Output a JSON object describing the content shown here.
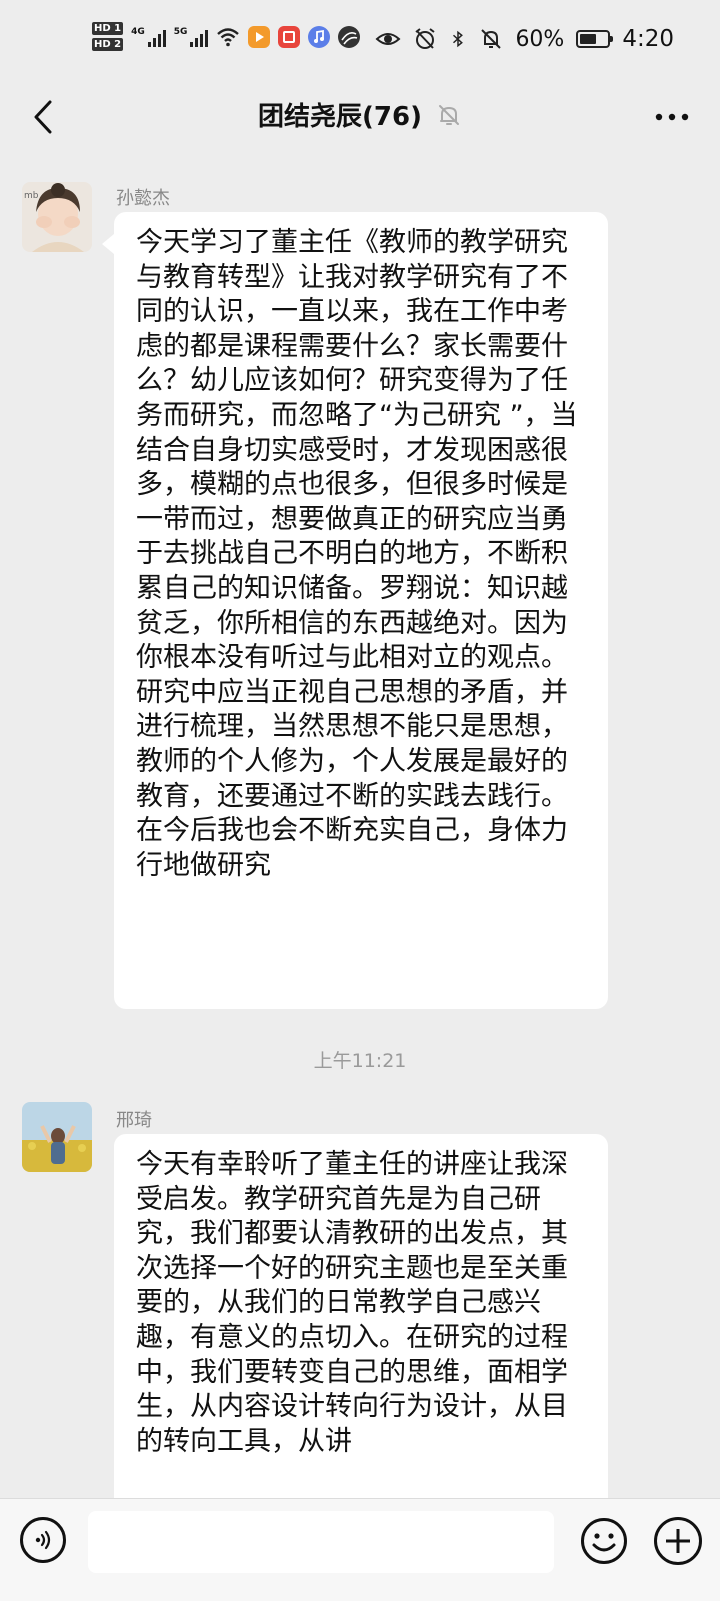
{
  "status_bar": {
    "hd_badges": [
      "HD 1",
      "HD 2"
    ],
    "network_1": "4G",
    "network_2": "5G",
    "battery_text": "60%",
    "battery_level": 0.6,
    "time": "4:20"
  },
  "header": {
    "title": "团结尧辰(76)"
  },
  "messages": [
    {
      "sender": "孙懿杰",
      "text": "今天学习了董主任《教师的教学研究与教育转型》让我对教学研究有了不同的认识，一直以来，我在工作中考虑的都是课程需要什么？家长需要什么？幼儿应该如何？研究变得为了任务而研究，而忽略了“为己研究 ”，当结合自身切实感受时，才发现困惑很多，模糊的点也很多，但很多时候是一带而过，想要做真正的研究应当勇于去挑战自己不明白的地方，不断积累自己的知识储备。罗翔说：知识越贫乏，你所相信的东西越绝对。因为你根本没有听过与此相对立的观点。研究中应当正视自己思想的矛盾，并进行梳理，当然思想不能只是思想，教师的个人修为，个人发展是最好的教育，还要通过不断的实践去践行。在今后我也会不断充实自己，身体力行地做研究"
    },
    {
      "sender": "邢琦",
      "text": "今天有幸聆听了董主任的讲座让我深受启发。教学研究首先是为自己研究，我们都要认清教研的出发点，其次选择一个好的研究主题也是至关重要的，从我们的日常教学自己感兴趣，有意义的点切入。在研究的过程中，我们要转变自己的思维，面相学生，从内容设计转向行为设计，从目的转向工具，从讲"
    }
  ],
  "timestamp": "上午11:21",
  "input_bar": {
    "placeholder": ""
  },
  "icons": {
    "back": "chevron-left-icon",
    "mute": "bell-off-icon",
    "more": "more-dots-icon",
    "voice": "voice-icon",
    "emoji": "emoji-icon",
    "plus": "plus-icon"
  }
}
